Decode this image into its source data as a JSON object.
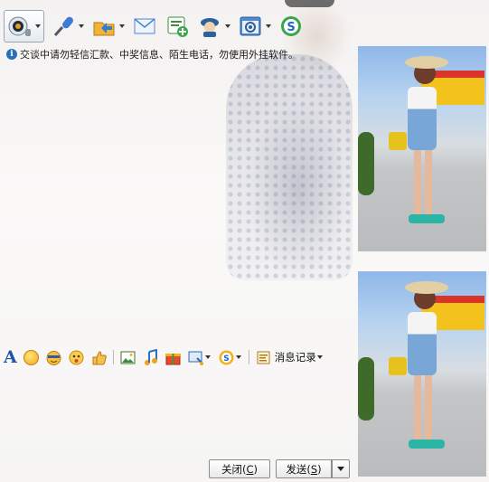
{
  "toolbar": {
    "buttons": [
      {
        "icon": "video-call-icon",
        "has_dropdown": true
      },
      {
        "icon": "voice-call-icon",
        "has_dropdown": true
      },
      {
        "icon": "send-file-icon",
        "has_dropdown": true
      },
      {
        "icon": "email-icon",
        "has_dropdown": false
      },
      {
        "icon": "create-group-icon",
        "has_dropdown": false
      },
      {
        "icon": "remote-assist-icon",
        "has_dropdown": true
      },
      {
        "icon": "app-settings-icon",
        "has_dropdown": true
      },
      {
        "icon": "soso-icon",
        "has_dropdown": false
      }
    ]
  },
  "notice": {
    "text": "交谈中请勿轻信汇款、中奖信息、陌生电话，勿使用外挂软件。"
  },
  "input_toolbar": {
    "font_glyph": "A",
    "record_label": "消息记录"
  },
  "actions": {
    "close_label": "关闭",
    "close_key": "C",
    "send_label": "发送",
    "send_key": "S"
  },
  "colors": {
    "accent_blue": "#1f55a8",
    "send_dropdown": "#222222"
  }
}
